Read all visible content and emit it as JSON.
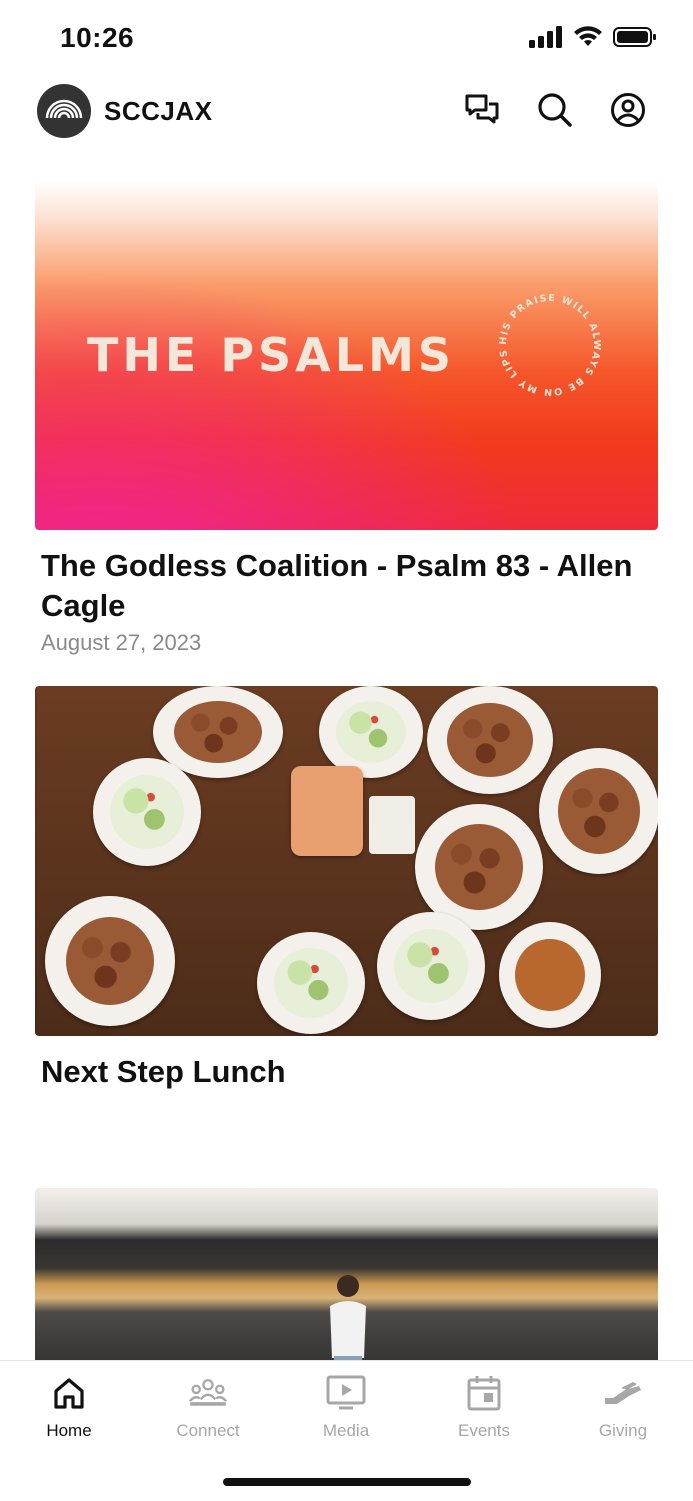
{
  "status_bar": {
    "time": "10:26"
  },
  "header": {
    "brand": "SCCJAX",
    "icons": [
      "chat-icon",
      "search-icon",
      "profile-icon"
    ]
  },
  "feed": [
    {
      "image": {
        "title": "THE PSALMS",
        "ring_text": "HIS PRAISE WILL ALWAYS BE ON MY LIPS"
      },
      "title": "The Godless Coalition - Psalm 83 - Allen Cagle",
      "date": "August 27, 2023"
    },
    {
      "title": "Next Step Lunch"
    }
  ],
  "tabs": [
    {
      "label": "Home",
      "icon": "home-icon",
      "active": true
    },
    {
      "label": "Connect",
      "icon": "people-icon",
      "active": false
    },
    {
      "label": "Media",
      "icon": "media-icon",
      "active": false
    },
    {
      "label": "Events",
      "icon": "calendar-icon",
      "active": false
    },
    {
      "label": "Giving",
      "icon": "giving-hand-icon",
      "active": false
    }
  ],
  "colors": {
    "active": "#111111",
    "inactive": "#a7a7a7",
    "psalms_text": "#f2e7d8"
  }
}
